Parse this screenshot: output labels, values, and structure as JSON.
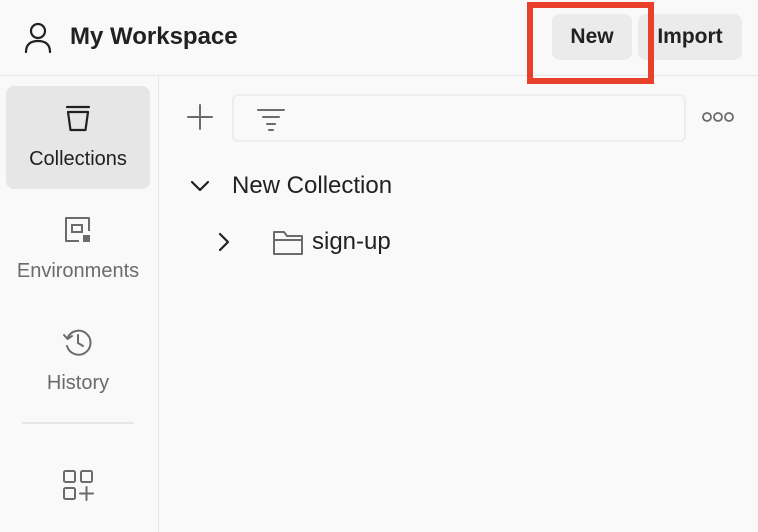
{
  "header": {
    "workspace_title": "My Workspace",
    "new_label": "New",
    "import_label": "Import",
    "workspace_icon": "user-icon",
    "highlight_color": "#e8402a"
  },
  "sidebar": {
    "items": [
      {
        "label": "Collections",
        "icon": "trash-can-icon",
        "active": true
      },
      {
        "label": "Environments",
        "icon": "environment-icon",
        "active": false
      },
      {
        "label": "History",
        "icon": "history-icon",
        "active": false
      }
    ],
    "bottom_icon": "apps-add-icon"
  },
  "toolbar": {
    "add_icon": "plus-icon",
    "filter_icon": "filter-icon",
    "more_icon": "more-options-icon",
    "search_placeholder": ""
  },
  "tree": {
    "collection": {
      "label": "New Collection",
      "expanded": true,
      "children": [
        {
          "label": "sign-up",
          "type": "folder",
          "expanded": false
        }
      ]
    }
  },
  "colors": {
    "background": "#f9f9f9",
    "active_item": "#e6e6e6",
    "button": "#ebebeb",
    "text": "#212121",
    "muted_text": "#6b6b6b"
  }
}
